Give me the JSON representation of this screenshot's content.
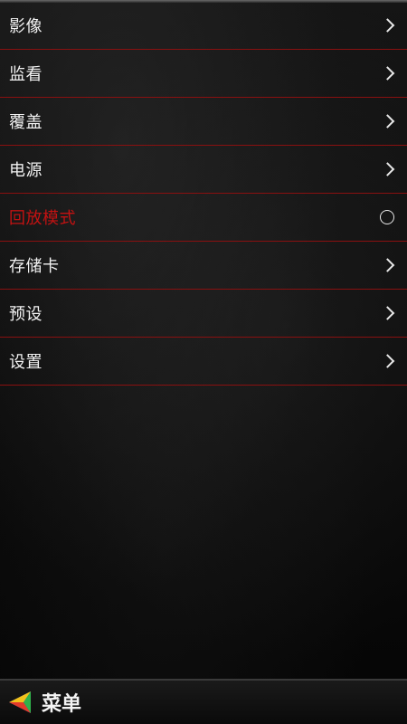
{
  "menu": {
    "items": [
      {
        "label": "影像"
      },
      {
        "label": "监看"
      },
      {
        "label": "覆盖"
      },
      {
        "label": "电源"
      },
      {
        "label": "回放模式"
      },
      {
        "label": "存储卡"
      },
      {
        "label": "预设"
      },
      {
        "label": "设置"
      }
    ]
  },
  "bottom_bar": {
    "title": "菜单",
    "logo_icon": "app-logo-icon"
  },
  "colors": {
    "accent_red": "#c31212",
    "divider_red": "#8a1010",
    "text": "#f2f2f2",
    "background": "#0b0b0b"
  },
  "icons": {
    "chevron": "chevron-right-icon",
    "radio": "radio-circle-icon"
  }
}
